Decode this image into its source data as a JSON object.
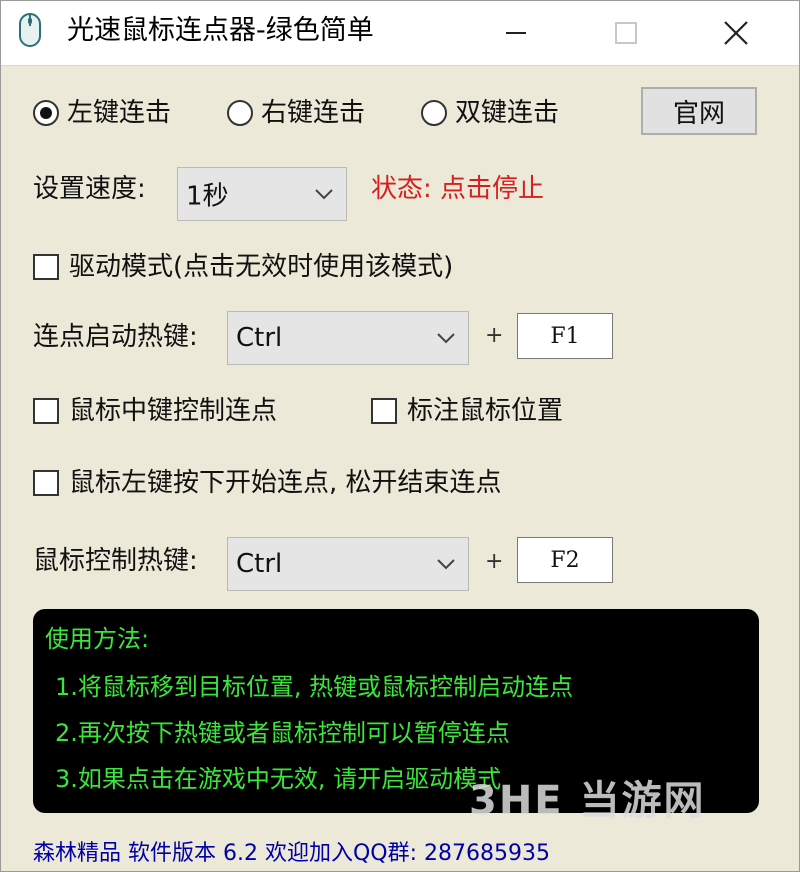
{
  "window": {
    "title": "光速鼠标连点器-绿色简单"
  },
  "click_mode": {
    "options": [
      {
        "label": "左键连击",
        "selected": true
      },
      {
        "label": "右键连击",
        "selected": false
      },
      {
        "label": "双键连击",
        "selected": false
      }
    ],
    "website_button": "官网"
  },
  "speed": {
    "label": "设置速度:",
    "value": "1秒",
    "status": "状态: 点击停止",
    "status_color": "#d42020"
  },
  "driver_mode": {
    "label": "驱动模式(点击无效时使用该模式)",
    "checked": false
  },
  "start_hotkey": {
    "label": "连点启动热键:",
    "modifier": "Ctrl",
    "plus": "+",
    "key": "F1"
  },
  "options": {
    "middle_button": {
      "label": "鼠标中键控制连点",
      "checked": false
    },
    "mark_position": {
      "label": "标注鼠标位置",
      "checked": false
    },
    "left_hold": {
      "label": "鼠标左键按下开始连点, 松开结束连点",
      "checked": false
    }
  },
  "mouse_hotkey": {
    "label": "鼠标控制热键:",
    "modifier": "Ctrl",
    "plus": "+",
    "key": "F2"
  },
  "instructions": {
    "heading": "使用方法:",
    "lines": [
      "1.将鼠标移到目标位置, 热键或鼠标控制启动连点",
      "2.再次按下热键或者鼠标控制可以暂停连点",
      "3.如果点击在游戏中无效, 请开启驱动模式"
    ],
    "text_color": "#39e639"
  },
  "watermark": "3HE 当游网",
  "footer": "森林精品 软件版本 6.2 欢迎加入QQ群: 287685935"
}
